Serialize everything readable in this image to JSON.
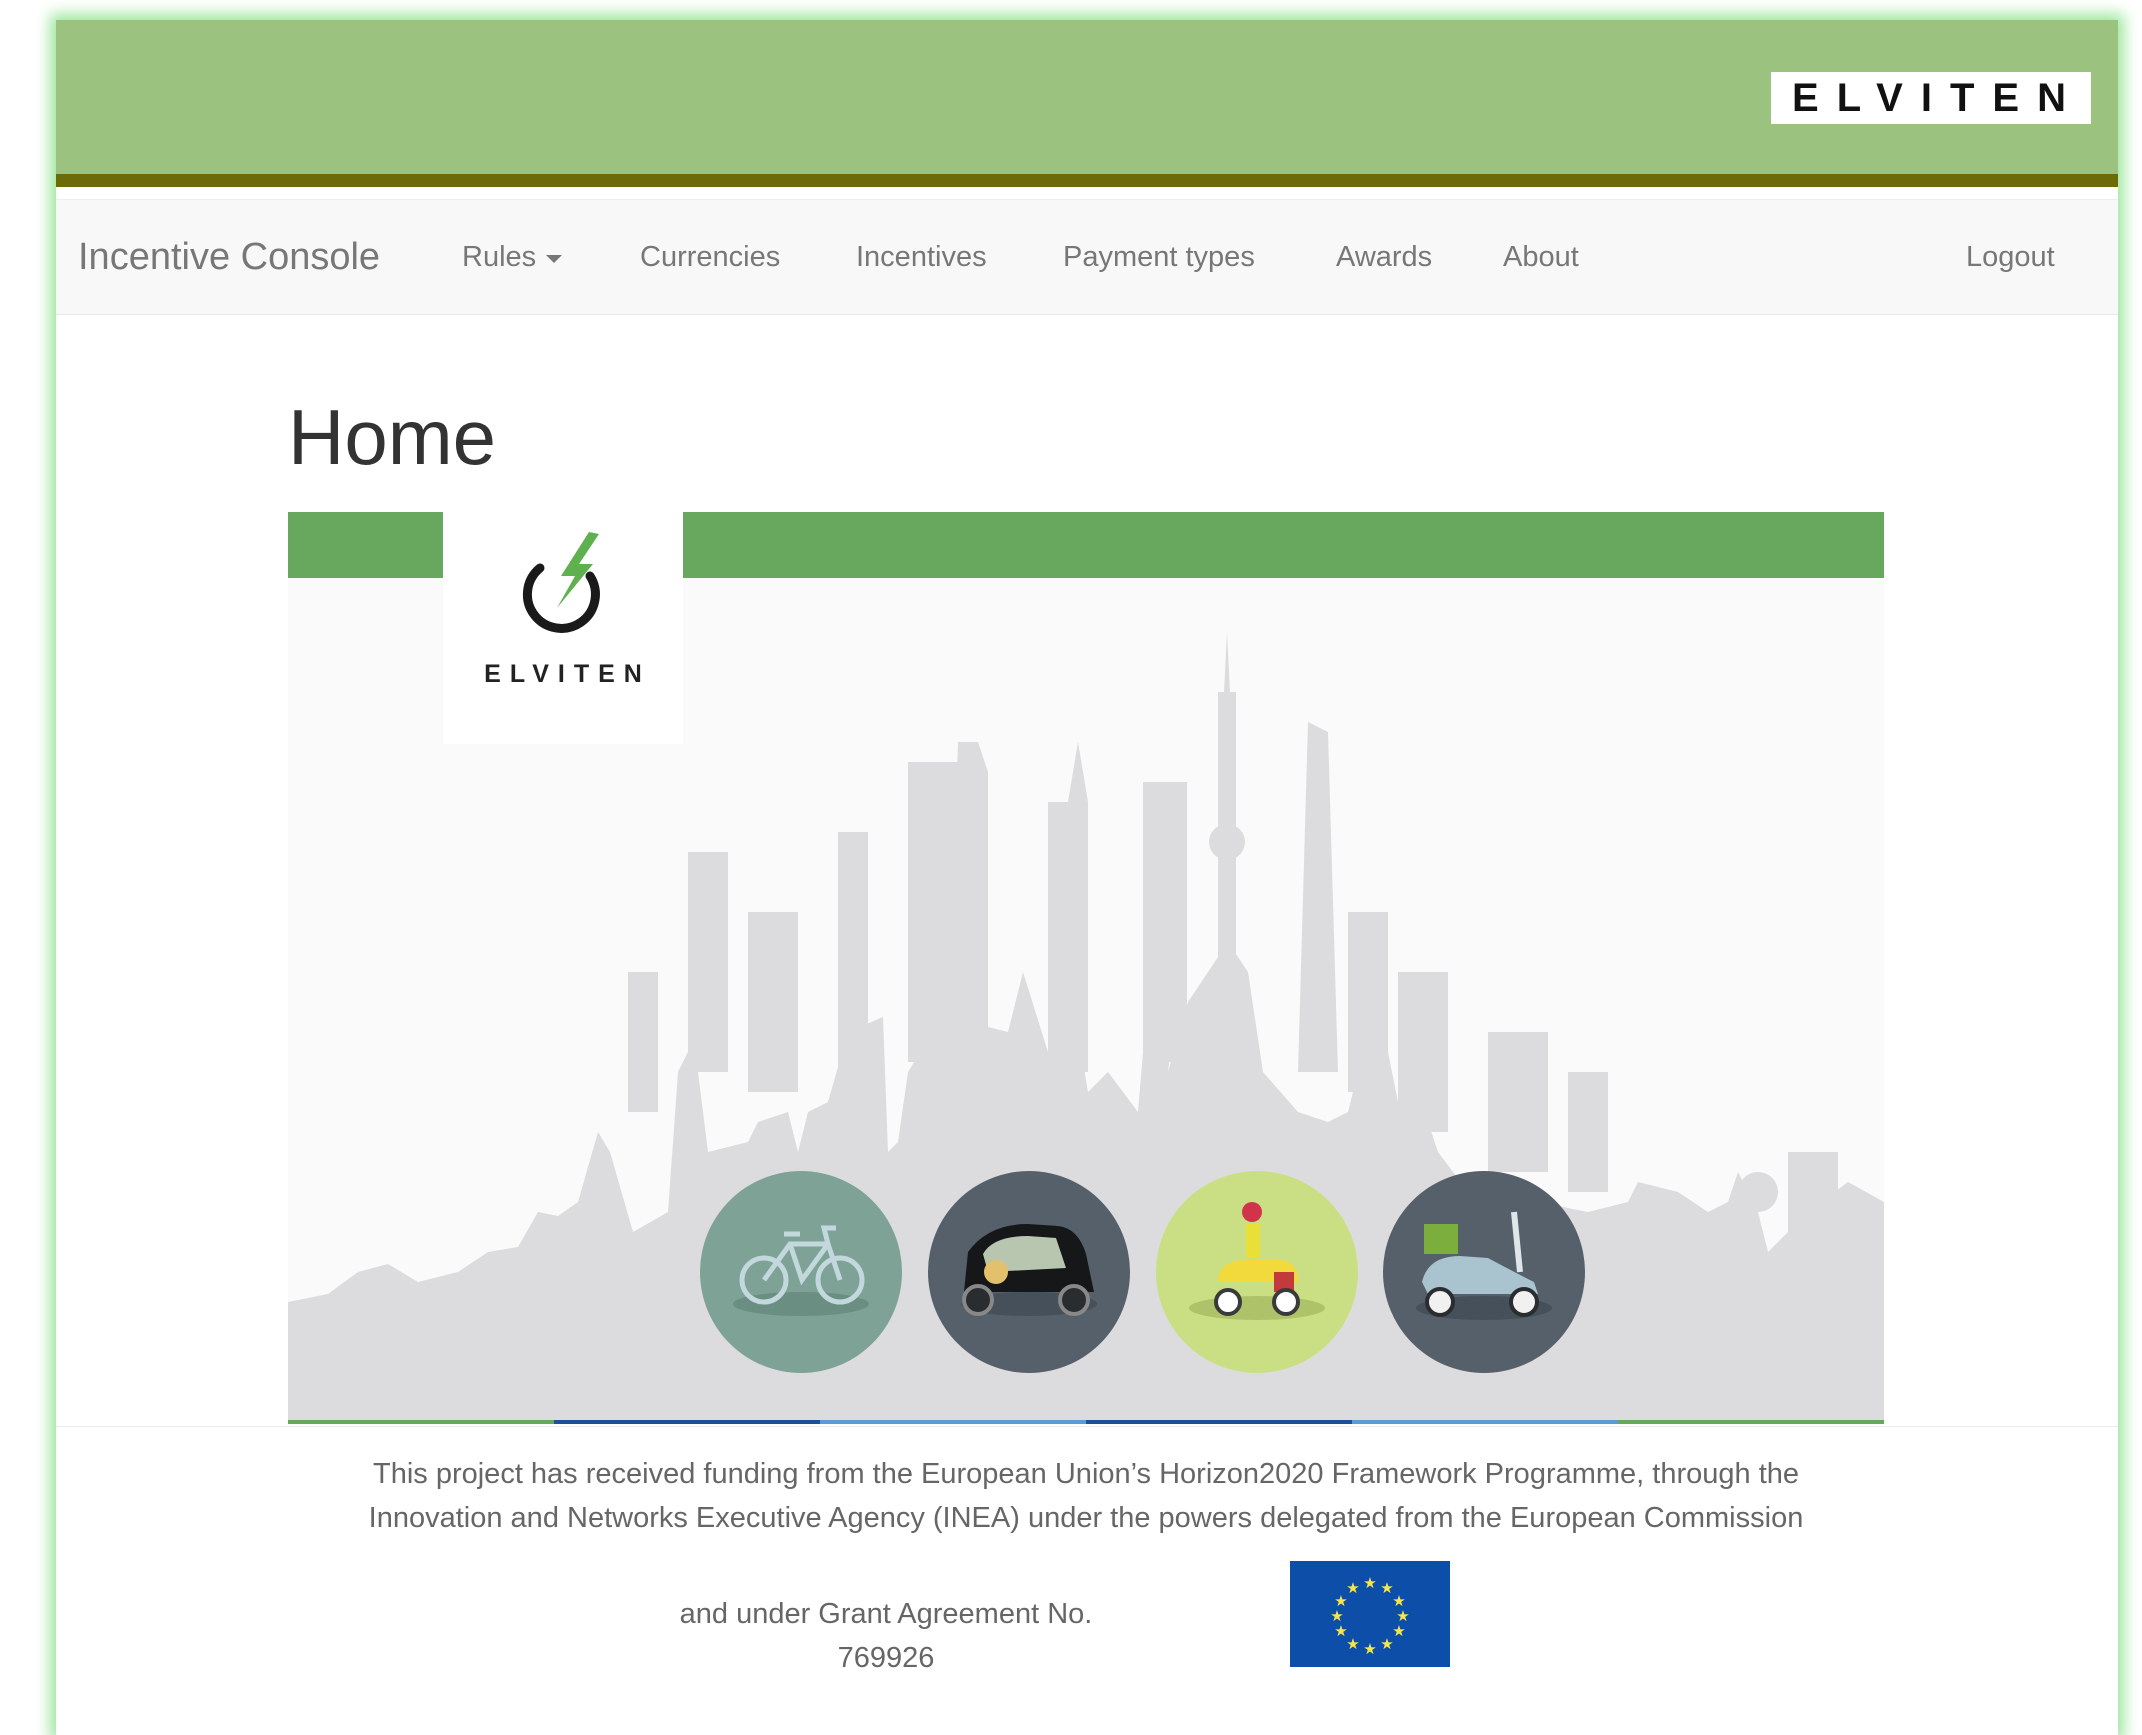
{
  "header": {
    "brand_logo_text": "ELVITEN",
    "banner_color": "#9cc27f",
    "strip_color": "#6b6c08"
  },
  "navbar": {
    "brand": "Incentive Console",
    "items": [
      {
        "label": "Rules",
        "dropdown": true
      },
      {
        "label": "Currencies"
      },
      {
        "label": "Incentives"
      },
      {
        "label": "Payment types"
      },
      {
        "label": "Awards"
      },
      {
        "label": "About"
      }
    ],
    "logout": "Logout"
  },
  "main": {
    "title": "Home",
    "hero": {
      "logo_text": "ELVITEN",
      "accent_color": "#68a85e",
      "vehicles": [
        {
          "icon": "bicycle-icon",
          "color": "#7ea396"
        },
        {
          "icon": "electric-car-icon",
          "color": "#56606b"
        },
        {
          "icon": "scooter-rider-icon",
          "color": "#cadf84"
        },
        {
          "icon": "delivery-scooter-icon",
          "color": "#56606b"
        }
      ]
    }
  },
  "footer": {
    "line1": "This project has received funding from the European Union’s Horizon2020 Framework Programme, through the",
    "line2": "Innovation and Networks Executive Agency (INEA) under the powers delegated from the European Commission",
    "line3": "and under Grant Agreement No. 769926",
    "flag_icon": "eu-flag-icon"
  }
}
